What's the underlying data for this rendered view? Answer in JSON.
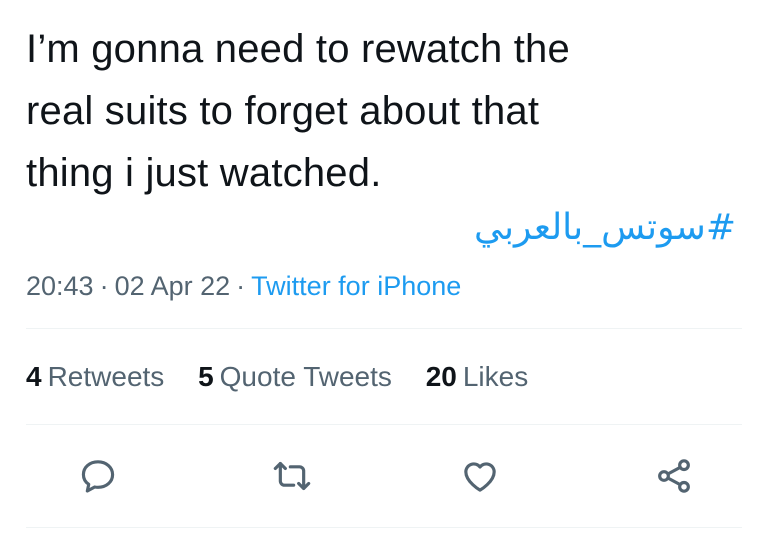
{
  "tweet": {
    "text_lines": [
      "I’m gonna need to rewatch the",
      "real suits to forget about that",
      "thing i just watched."
    ],
    "hashtag": "#سوتس_بالعربي",
    "time": "20:43",
    "date": "02 Apr 22",
    "separator": "·",
    "source": "Twitter for iPhone"
  },
  "stats": {
    "retweets": {
      "count": "4",
      "label": "Retweets"
    },
    "quote_tweets": {
      "count": "5",
      "label": "Quote Tweets"
    },
    "likes": {
      "count": "20",
      "label": "Likes"
    }
  },
  "actions": {
    "reply_icon": "reply-icon",
    "retweet_icon": "retweet-icon",
    "like_icon": "heart-icon",
    "share_icon": "share-icon"
  },
  "colors": {
    "text": "#0f1419",
    "secondary": "#536471",
    "accent": "#1d9bf0",
    "divider": "#eff3f4"
  }
}
